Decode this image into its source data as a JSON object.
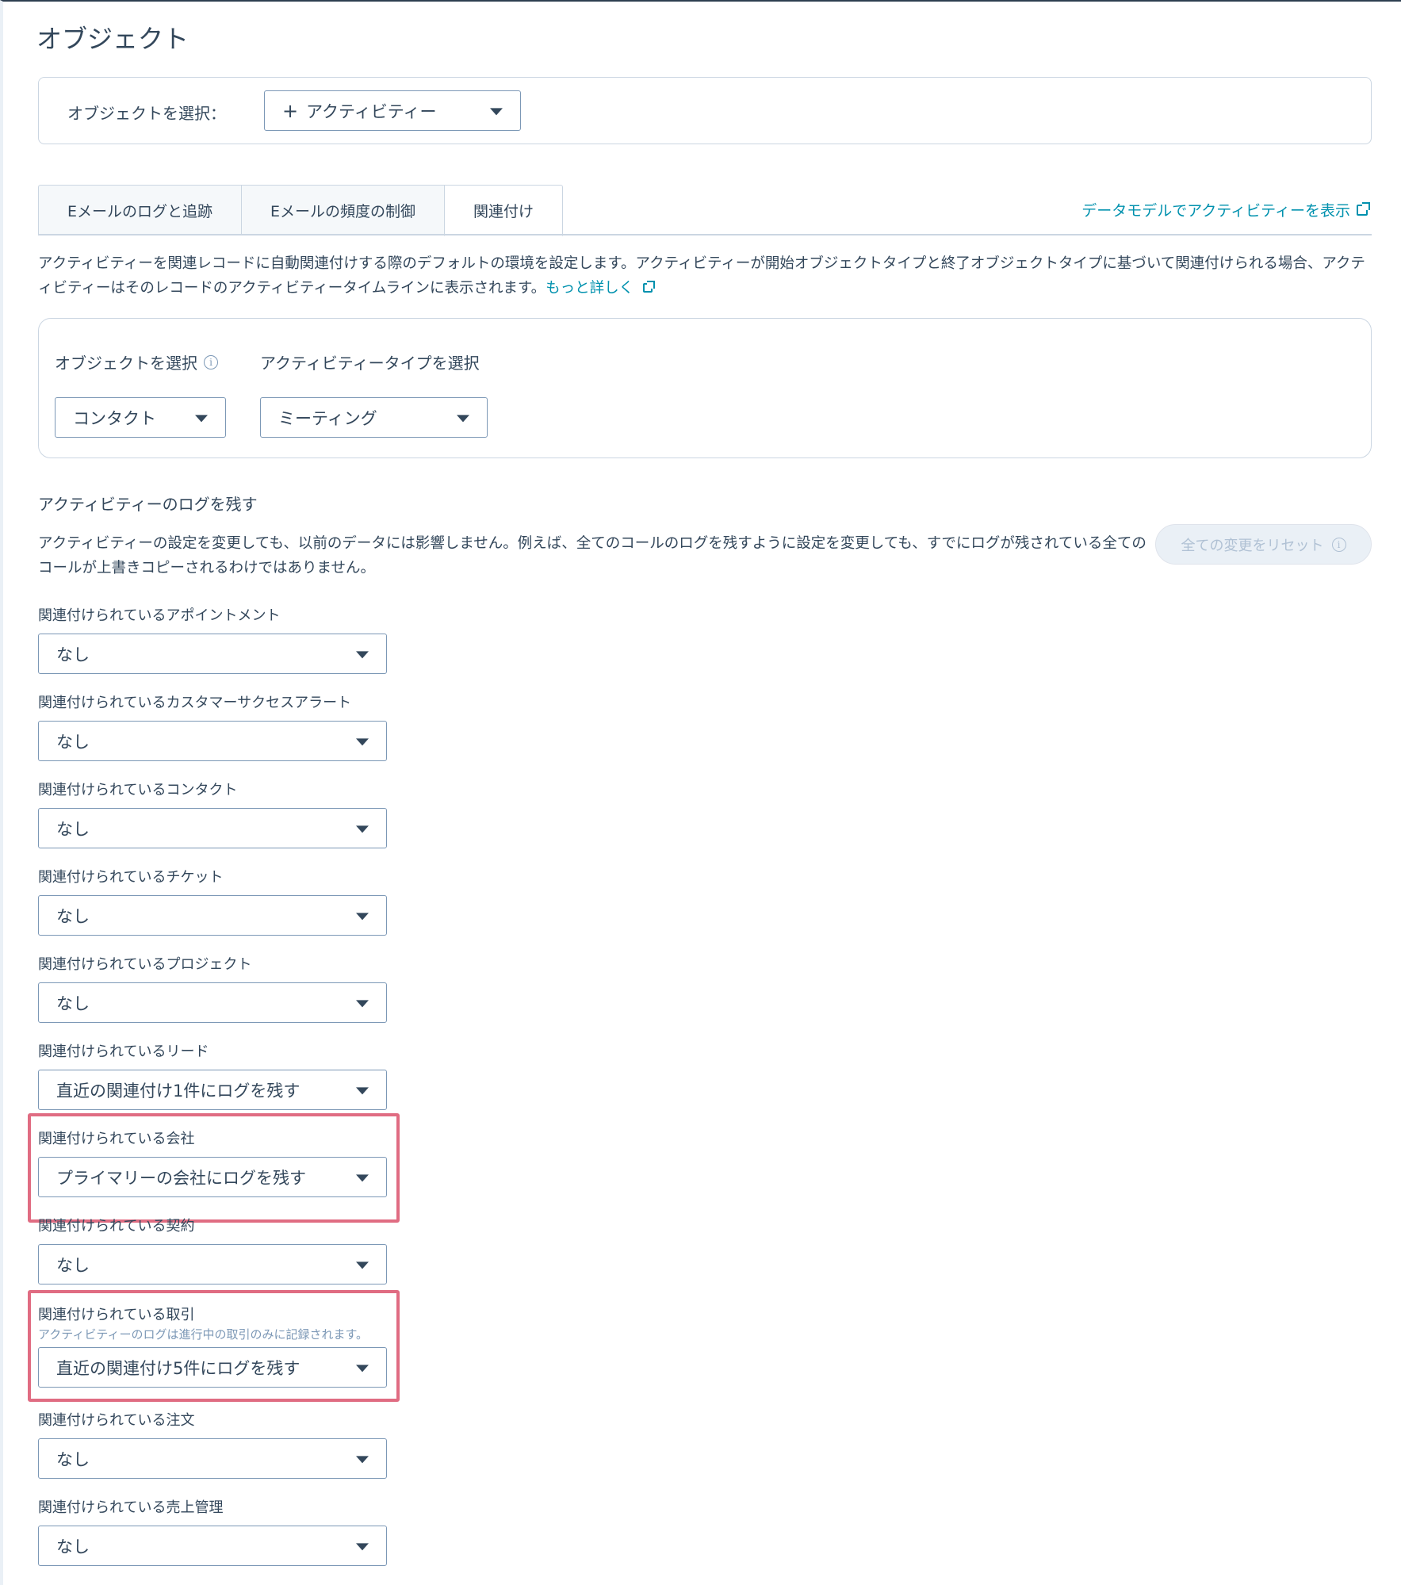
{
  "page_title": "オブジェクト",
  "object_selector": {
    "label": "オブジェクトを選択：",
    "plus": "+",
    "value": "アクティビティー"
  },
  "tabs": [
    {
      "label": "Eメールのログと追跡",
      "active": false
    },
    {
      "label": "Eメールの頻度の制御",
      "active": false
    },
    {
      "label": "関連付け",
      "active": true
    }
  ],
  "data_model_link": "データモデルでアクティビティーを表示",
  "description": {
    "text": "アクティビティーを関連レコードに自動関連付けする際のデフォルトの環境を設定します。アクティビティーが開始オブジェクトタイプと終了オブジェクトタイプに基づいて関連付けられる場合、アクティビティーはそのレコードのアクティビティータイムラインに表示されます。",
    "link": "もっと詳しく"
  },
  "filters": {
    "object_label": "オブジェクトを選択",
    "object_value": "コンタクト",
    "activity_type_label": "アクティビティータイプを選択",
    "activity_type_value": "ミーティング"
  },
  "log_section": {
    "title": "アクティビティーのログを残す",
    "note": "アクティビティーの設定を変更しても、以前のデータには影響しません。例えば、全てのコールのログを残すように設定を変更しても、すでにログが残されている全てのコールが上書きコピーされるわけではありません。",
    "reset_button": "全ての変更をリセット"
  },
  "fields": [
    {
      "label": "関連付けられているアポイントメント",
      "value": "なし"
    },
    {
      "label": "関連付けられているカスタマーサクセスアラート",
      "value": "なし"
    },
    {
      "label": "関連付けられているコンタクト",
      "value": "なし"
    },
    {
      "label": "関連付けられているチケット",
      "value": "なし"
    },
    {
      "label": "関連付けられているプロジェクト",
      "value": "なし"
    },
    {
      "label": "関連付けられているリード",
      "value": "直近の関連付け1件にログを残す"
    },
    {
      "label": "関連付けられている会社",
      "value": "プライマリーの会社にログを残す"
    },
    {
      "label": "関連付けられている契約",
      "value": "なし"
    },
    {
      "label": "関連付けられている取引",
      "help": "アクティビティーのログは進行中の取引のみに記録されます。",
      "value": "直近の関連付け5件にログを残す"
    },
    {
      "label": "関連付けられている注文",
      "value": "なし"
    },
    {
      "label": "関連付けられている売上管理",
      "value": "なし"
    }
  ],
  "colors": {
    "text": "#33475b",
    "link": "#0091ae",
    "border": "#cbd6e2",
    "highlight": "#e06c82"
  }
}
